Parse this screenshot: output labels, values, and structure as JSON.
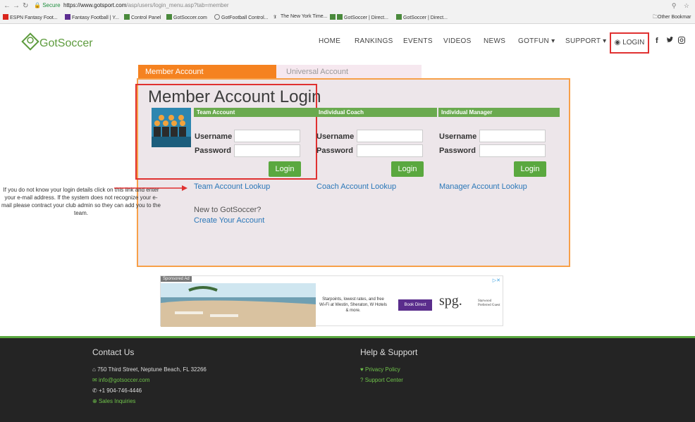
{
  "browser": {
    "secure_label": "Secure",
    "url_host": "https://www.gotsport.com",
    "url_path": "/asp/users/login_menu.asp?tab=member",
    "bookmarks": [
      "ESPN Fantasy Foot...",
      "Fantasy Football | Y...",
      "Control Panel",
      "GotSoccer.com",
      "GotFootball Control...",
      "The New York Time...",
      "GotSoccer | Direct...",
      "GotSoccer | Direct..."
    ],
    "other_bookmarks": "Other Bookmar"
  },
  "header": {
    "logo_got": "Got",
    "logo_soccer": "Soccer",
    "nav": [
      "HOME",
      "RANKINGS",
      "EVENTS",
      "VIDEOS",
      "NEWS",
      "GOTFUN ▾",
      "SUPPORT ▾"
    ],
    "login": "LOGIN",
    "social": [
      "f",
      "t",
      "ig"
    ]
  },
  "tabs": {
    "member": "Member Account",
    "universal": "Universal Account"
  },
  "login": {
    "title": "Member Account Login",
    "username_label": "Username",
    "password_label": "Password",
    "login_button": "Login",
    "accounts": [
      {
        "header": "Team Account",
        "lookup": "Team Account Lookup"
      },
      {
        "header": "Individual Coach",
        "lookup": "Coach Account Lookup"
      },
      {
        "header": "Individual Manager",
        "lookup": "Manager Account Lookup"
      }
    ],
    "new_text": "New to GotSoccer?",
    "create_link": "Create Your Account"
  },
  "annotation": "If you do not know your login details click on this link and enter your e-mail address. If the system does not recognize your e-mail please contract your club admin so they can add you to the team.",
  "ad": {
    "label": "Sponsored Ad",
    "text": "Starpoints, lowest rates, and free Wi-Fi at Westin, Sheraton, W Hotels & more.",
    "button": "Book Direct",
    "logo": "spg.",
    "logo_sub": "Starwood Preferred Guest"
  },
  "footer": {
    "contact_title": "Contact Us",
    "address": "750 Third Street, Neptune Beach, FL 32266",
    "email": "info@gotsoccer.com",
    "phone": "+1 904-746-4446",
    "sales": "Sales Inquiries",
    "help_title": "Help & Support",
    "privacy": "Privacy Policy",
    "support": "Support Center"
  },
  "colors": {
    "brand_green": "#5aa83f",
    "accent_orange": "#f58220",
    "highlight_red": "#e03131"
  }
}
